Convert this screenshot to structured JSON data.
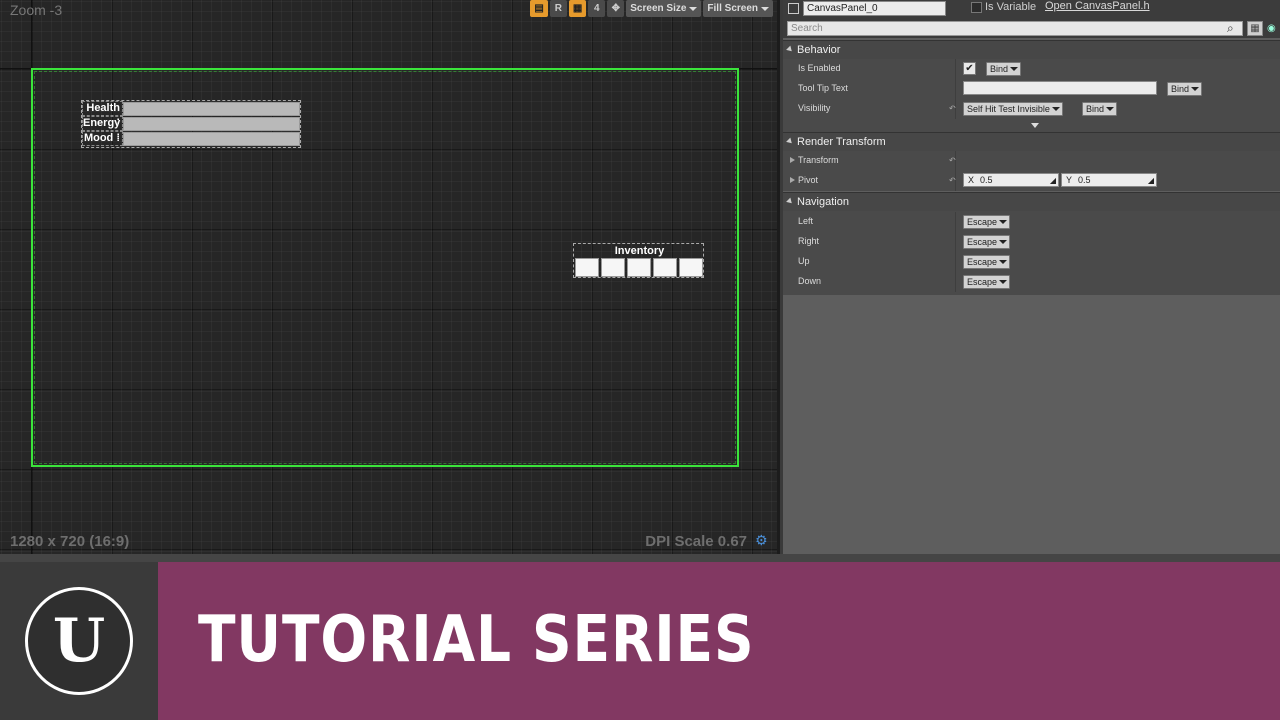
{
  "viewport": {
    "zoom": "Zoom -3",
    "resolution": "1280 x 720 (16:9)",
    "dpi": "DPI Scale 0.67",
    "toolbar": {
      "r_button": "R",
      "four_button": "4",
      "screen_size": "Screen Size",
      "fill_screen": "Fill Screen"
    },
    "stats": [
      {
        "label": "Health :"
      },
      {
        "label": "Energy :"
      },
      {
        "label": "Mood :"
      }
    ],
    "inventory": {
      "title": "Inventory",
      "slot_count": 5
    }
  },
  "details": {
    "widget_name": "CanvasPanel_0",
    "is_variable_label": "Is Variable",
    "open_link": "Open CanvasPanel.h",
    "search_placeholder": "Search",
    "behavior": {
      "header": "Behavior",
      "is_enabled_label": "Is Enabled",
      "is_enabled_checked": true,
      "tooltip_label": "Tool Tip Text",
      "visibility_label": "Visibility",
      "visibility_value": "Self Hit Test Invisible",
      "bind_label": "Bind"
    },
    "render_transform": {
      "header": "Render Transform",
      "transform_label": "Transform",
      "pivot_label": "Pivot",
      "pivot_x_axis": "X",
      "pivot_x": "0.5",
      "pivot_y_axis": "Y",
      "pivot_y": "0.5"
    },
    "navigation": {
      "header": "Navigation",
      "rows": [
        {
          "label": "Left",
          "value": "Escape"
        },
        {
          "label": "Right",
          "value": "Escape"
        },
        {
          "label": "Up",
          "value": "Escape"
        },
        {
          "label": "Down",
          "value": "Escape"
        }
      ]
    }
  },
  "banner": {
    "title": "TUTORIAL SERIES",
    "logo_glyph": "U",
    "color": "#823862"
  }
}
